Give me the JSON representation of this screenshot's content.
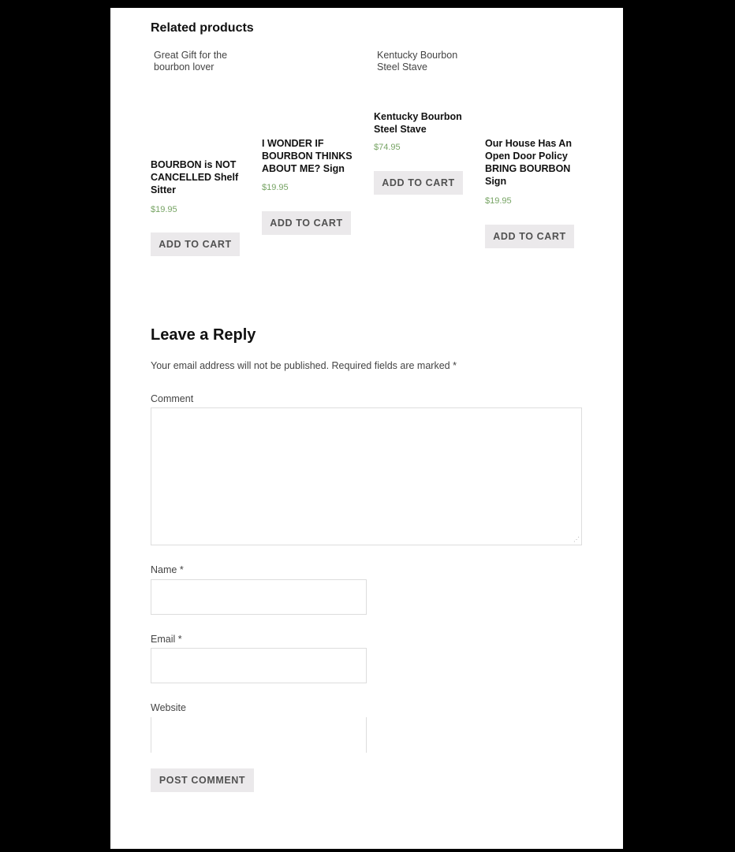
{
  "related": {
    "heading": "Related products",
    "image_alts": [
      "Great Gift for the bourbon lover",
      "Kentucky Bourbon Steel Stave"
    ],
    "products": [
      {
        "title": "BOURBON is NOT CANCELLED Shelf Sitter",
        "price": "$19.95",
        "button": "ADD TO CART"
      },
      {
        "title": "I WONDER IF BOURBON THINKS ABOUT ME? Sign",
        "price": "$19.95",
        "button": "ADD TO CART"
      },
      {
        "title": "Kentucky Bourbon Steel Stave",
        "price": "$74.95",
        "button": "ADD TO CART"
      },
      {
        "title": "Our House Has An Open Door Policy BRING BOURBON Sign",
        "price": "$19.95",
        "button": "ADD TO CART"
      }
    ]
  },
  "reply": {
    "heading": "Leave a Reply",
    "notes": "Your email address will not be published. Required fields are marked *",
    "comment_label": "Comment",
    "name_label": "Name *",
    "email_label": "Email *",
    "website_label": "Website",
    "submit": "POST COMMENT",
    "values": {
      "comment": "",
      "name": "",
      "email": "",
      "website": ""
    }
  },
  "colors": {
    "price": "#77a464",
    "button_bg": "#ebe9eb",
    "background": "#000000"
  }
}
